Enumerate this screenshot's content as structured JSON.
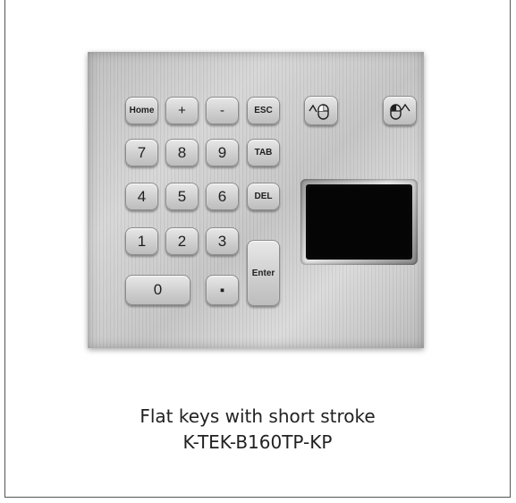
{
  "keypad": {
    "keys": {
      "home": "Home",
      "plus": "+",
      "minus": "-",
      "esc": "ESC",
      "k7": "7",
      "k8": "8",
      "k9": "9",
      "tab": "TAB",
      "k4": "4",
      "k5": "5",
      "k6": "6",
      "del": "DEL",
      "k1": "1",
      "k2": "2",
      "k3": "3",
      "enter": "Enter",
      "k0": "0",
      "dot": "▪"
    },
    "icons": [
      "left-mouse-button-icon",
      "right-mouse-button-icon"
    ]
  },
  "caption": {
    "line1": "Flat keys with short stroke",
    "line2": "K-TEK-B160TP-KP"
  }
}
